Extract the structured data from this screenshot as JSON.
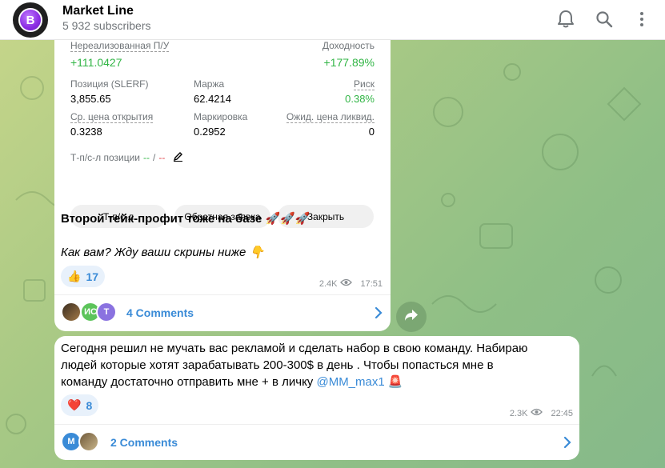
{
  "header": {
    "title": "Market Line",
    "subscribers": "5 932 subscribers",
    "avatar_letter": "B",
    "icons": [
      "bell-icon",
      "search-icon",
      "more-vertical-icon"
    ]
  },
  "post1": {
    "stats": {
      "unrealized_label": "Нереализованная П/У",
      "unrealized_value": "+111.0427",
      "yield_label": "Доходность",
      "yield_value": "+177.89%",
      "position_label": "Позиция (SLERF)",
      "position_value": "3,855.65",
      "margin_label": "Маржа",
      "margin_value": "62.4214",
      "risk_label": "Риск",
      "risk_value": "0.38%",
      "avg_open_label": "Ср. цена открытия",
      "avg_open_value": "0.3238",
      "mark_label": "Маркировка",
      "mark_value": "0.2952",
      "liq_label": "Ожид. цена ликвид.",
      "liq_value": "0",
      "tpsl_label": "Т-п/с-л позиции",
      "tpsl_value1": "--",
      "tpsl_sep": "/",
      "tpsl_value2": "--"
    },
    "buttons": {
      "tpsl": "Т-п/с-л",
      "reverse": "Обратная заявка",
      "close": "Закрыть"
    },
    "text_line1": "Второй тейк-профит тоже на базе 🚀🚀🚀",
    "text_line2": "Как вам? Жду ваши скрины ниже 👇",
    "reaction_emoji": "👍",
    "reaction_count": "17",
    "views": "2.4K",
    "time": "17:51",
    "comments": "4 Comments",
    "comment_avatars": [
      "ИС",
      "T"
    ]
  },
  "post2": {
    "text_line1": "Сегодня решил не мучать вас рекламой и сделать набор в свою команду. Набираю",
    "text_line2": "людей которые хотят зарабатывать 200-300$ в день . Чтобы попасться мне в",
    "text_line3_prefix": "команду достаточно отправить мне + в личку ",
    "mention": "@MM_max1",
    "text_line3_emoji": "🚨",
    "reaction_emoji": "❤️",
    "reaction_count": "8",
    "views": "2.3K",
    "time": "22:45",
    "comments": "2 Comments",
    "comment_avatars": [
      "M"
    ]
  },
  "colors": {
    "accent": "#3a8bd7",
    "green": "#31b545",
    "header_bg": "#ffffff"
  }
}
